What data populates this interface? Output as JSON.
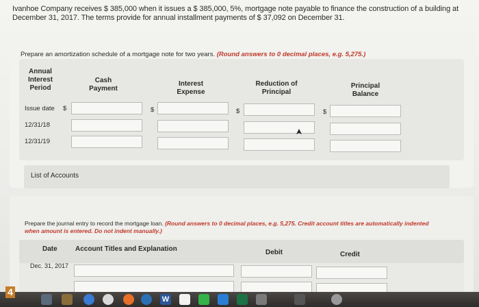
{
  "problem": {
    "text": "Ivanhoe Company receives $ 385,000 when it issues a $ 385,000, 5%, mortgage note payable to finance the construction of a building at December 31, 2017. The terms provide for annual installment payments of $ 37,092 on December 31."
  },
  "amortization": {
    "instruction": "Prepare an amortization schedule of a mortgage note for two years.",
    "hint": "(Round answers to 0 decimal places, e.g. 5,275.)",
    "headers": {
      "period": "Annual Interest Period",
      "cash": "Cash Payment",
      "interest": "Interest Expense",
      "reduction": "Reduction of Principal",
      "balance": "Principal Balance"
    },
    "rows": [
      {
        "label": "Issue date",
        "cash": "",
        "interest": "",
        "reduction": "",
        "balance": ""
      },
      {
        "label": "12/31/18",
        "cash": "",
        "interest": "",
        "reduction": "",
        "balance": ""
      },
      {
        "label": "12/31/19",
        "cash": "",
        "interest": "",
        "reduction": "",
        "balance": ""
      }
    ],
    "currency_symbol": "$",
    "list_of_accounts": "List of Accounts"
  },
  "journal": {
    "instruction": "Prepare the journal entry to record the mortgage loan.",
    "hint": "(Round answers to 0 decimal places, e.g. 5,275. Credit account titles are automatically indented when amount is entered. Do not indent manually.)",
    "headers": {
      "date": "Date",
      "account": "Account Titles and Explanation",
      "debit": "Debit",
      "credit": "Credit"
    },
    "rows": [
      {
        "date": "Dec. 31, 2017",
        "account": "",
        "debit": "",
        "credit": ""
      }
    ]
  },
  "taskbar": {
    "badge": "4",
    "icons": [
      "rocket-icon",
      "photo-icon",
      "safari-icon",
      "chrome-icon",
      "firefox-icon",
      "word-icon",
      "calendar-icon",
      "messages-icon",
      "excel-icon",
      "notes-icon",
      "dashboard-icon"
    ],
    "word_label": "W"
  }
}
